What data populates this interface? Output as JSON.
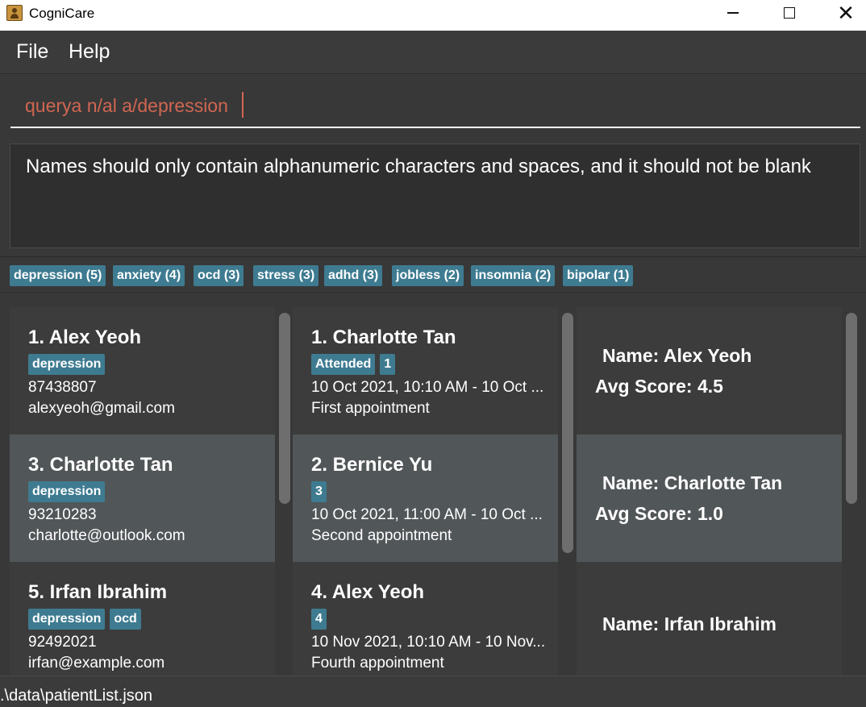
{
  "window": {
    "title": "CogniCare",
    "icon": "contact-book-icon"
  },
  "menu": {
    "file": "File",
    "help": "Help"
  },
  "command": {
    "value": "querya n/al a/depression"
  },
  "result": {
    "message": "Names should only contain alphanumeric characters and spaces, and it should not be blank"
  },
  "tags": [
    "depression (5)",
    "anxiety (4)",
    "ocd (3)",
    "stress (3)",
    "adhd (3)",
    "jobless (2)",
    "insomnia (2)",
    "bipolar (1)"
  ],
  "patients": [
    {
      "title": "1.  Alex Yeoh",
      "tags": [
        "depression"
      ],
      "phone": "87438807",
      "email": "alexyeoh@gmail.com"
    },
    {
      "title": "3.  Charlotte Tan",
      "tags": [
        "depression"
      ],
      "phone": "93210283",
      "email": "charlotte@outlook.com"
    },
    {
      "title": "5.  Irfan Ibrahim",
      "tags": [
        "depression",
        "ocd"
      ],
      "phone": "92492021",
      "email": "irfan@example.com"
    }
  ],
  "appointments": [
    {
      "title": "1.  Charlotte Tan",
      "tags": [
        "Attended",
        "1"
      ],
      "time": "10 Oct 2021, 10:10 AM - 10 Oct ...",
      "description": "First appointment"
    },
    {
      "title": "2.  Bernice Yu",
      "tags": [
        "3"
      ],
      "time": "10 Oct 2021, 11:00 AM - 10 Oct ...",
      "description": "Second appointment"
    },
    {
      "title": "4.  Alex Yeoh",
      "tags": [
        "4"
      ],
      "time": "10 Nov 2021, 10:10 AM - 10 Nov...",
      "description": "Fourth appointment"
    }
  ],
  "scores": [
    {
      "name": "Name: Alex Yeoh",
      "avg": "Avg Score: 4.5"
    },
    {
      "name": "Name: Charlotte Tan",
      "avg": "Avg Score: 1.0"
    },
    {
      "name": "Name: Irfan Ibrahim",
      "avg": ""
    }
  ],
  "status": {
    "path": ".\\data\\patientList.json"
  },
  "colors": {
    "tag_bg": "#3e7b91",
    "command_text": "#d06651",
    "selected_card": "#515658"
  }
}
